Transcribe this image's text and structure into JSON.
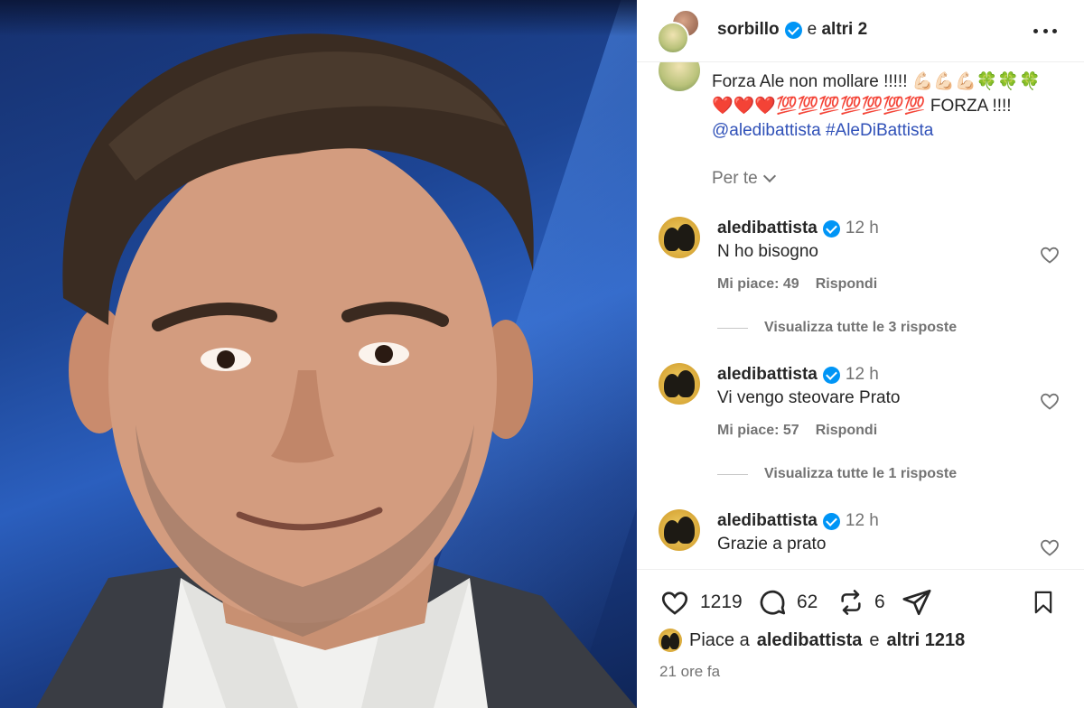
{
  "header": {
    "username": "sorbillo",
    "and_word": "e",
    "others": "altri 2"
  },
  "caption": {
    "text_line1": "Forza Ale non mollare !!!!! 💪🏻💪🏻💪🏻🍀🍀🍀",
    "text_line2": "❤️❤️❤️💯💯💯💯💯💯💯 FORZA !!!!",
    "tags": "@aledibattista #AleDiBattista"
  },
  "filter": {
    "label": "Per te"
  },
  "comments": [
    {
      "username": "aledibattista",
      "time": "12 h",
      "text": "N ho bisogno",
      "likes": "Mi piace: 49",
      "reply": "Rispondi",
      "view_replies": "Visualizza tutte le 3 risposte"
    },
    {
      "username": "aledibattista",
      "time": "12 h",
      "text": "Vi vengo steovare Prato",
      "likes": "Mi piace: 57",
      "reply": "Rispondi",
      "view_replies": "Visualizza tutte le 1 risposte"
    },
    {
      "username": "aledibattista",
      "time": "12 h",
      "text": "Grazie a prato"
    }
  ],
  "actions": {
    "like_count": "1219",
    "comment_count": "62",
    "repost_count": "6"
  },
  "liked_by": {
    "prefix": "Piace a",
    "user": "aledibattista",
    "and_word": "e",
    "others": "altri 1218"
  },
  "timestamp": "21 ore fa",
  "colors": {
    "verified": "#0095f6",
    "link": "#3051b8",
    "secondary_text": "#737373"
  },
  "icons": [
    "more-icon",
    "verified-icon",
    "heart-icon",
    "comment-icon",
    "repost-icon",
    "share-icon",
    "bookmark-icon",
    "chevron-down-icon"
  ]
}
